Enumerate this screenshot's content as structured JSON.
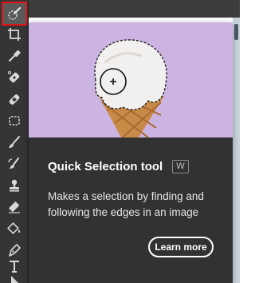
{
  "tooltip": {
    "title": "Quick Selection tool",
    "shortcut": "W",
    "description": "Makes a selection by finding and following the edges in an image",
    "learn_more_label": "Learn more"
  },
  "toolbar": {
    "tools": [
      {
        "name": "quick-selection-tool",
        "icon": "quick-selection-icon",
        "selected": true
      },
      {
        "name": "crop-tool",
        "icon": "crop-icon"
      },
      {
        "name": "eyedropper-tool",
        "icon": "eyedropper-icon"
      },
      {
        "name": "spot-healing-brush-tool",
        "icon": "spot-healing-icon"
      },
      {
        "name": "healing-brush-tool",
        "icon": "bandage-icon"
      },
      {
        "name": "patch-tool",
        "icon": "patch-icon"
      },
      {
        "name": "brush-tool",
        "icon": "brush-icon"
      },
      {
        "name": "history-brush-tool",
        "icon": "history-brush-icon"
      },
      {
        "name": "clone-stamp-tool",
        "icon": "clone-stamp-icon"
      },
      {
        "name": "eraser-tool",
        "icon": "eraser-icon"
      },
      {
        "name": "paint-bucket-tool",
        "icon": "paint-bucket-icon"
      },
      {
        "name": "pen-tool",
        "icon": "pen-icon"
      },
      {
        "name": "type-tool",
        "icon": "type-icon"
      },
      {
        "name": "path-selection-tool",
        "icon": "path-selection-icon"
      }
    ],
    "selected_outline_color": "#e5121b"
  },
  "colors": {
    "toolbar_bg": "#353535",
    "popover_bg": "#323232",
    "hero_bg": "#cbb3e2",
    "cone": "#c98a48"
  }
}
